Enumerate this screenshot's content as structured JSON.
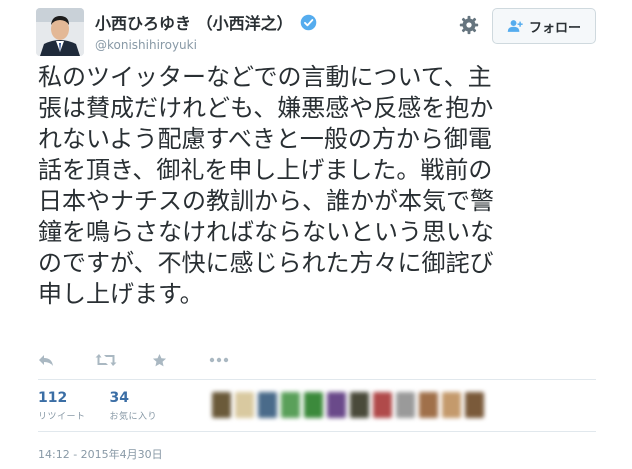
{
  "user": {
    "display_name": "小西ひろゆき （小西洋之）",
    "handle": "@konishihiroyuki"
  },
  "header": {
    "follow_label": "フォロー",
    "icons": [
      "gear-icon",
      "follow-user-icon",
      "verified-badge-icon"
    ]
  },
  "tweet": {
    "text": "私のツイッターなどでの言動について、主\n張は賛成だけれども、嫌悪感や反感を抱か\nれないよう配慮すべきと一般の方から御電\n話を頂き、御礼を申し上げました。戦前の\n日本やナチスの教訓から、誰かが本気で警\n鐘を鳴らさなければならないという思いな\nのですが、不快に感じられた方々に御詫び\n申し上げます。",
    "timestamp": "14:12 - 2015年4月30日"
  },
  "actions": [
    "reply-icon",
    "retweet-icon",
    "favorite-icon",
    "more-icon"
  ],
  "stats": {
    "retweets": {
      "count": "112",
      "label": "リツイート"
    },
    "favorites": {
      "count": "34",
      "label": "お気に入り"
    }
  },
  "faces": [
    "#6b5a3a",
    "#d9c9a0",
    "#4a6b8a",
    "#5aa05a",
    "#3c8a3c",
    "#6a4a8a",
    "#4a4a3a",
    "#b04a4a",
    "#9a9a9a",
    "#a0704a",
    "#c49a6c",
    "#7a5a3a"
  ],
  "colors": {
    "text": "#292f33",
    "muted": "#8899a6",
    "stat_accent": "#3b6ea5",
    "verified": "#55acee"
  }
}
